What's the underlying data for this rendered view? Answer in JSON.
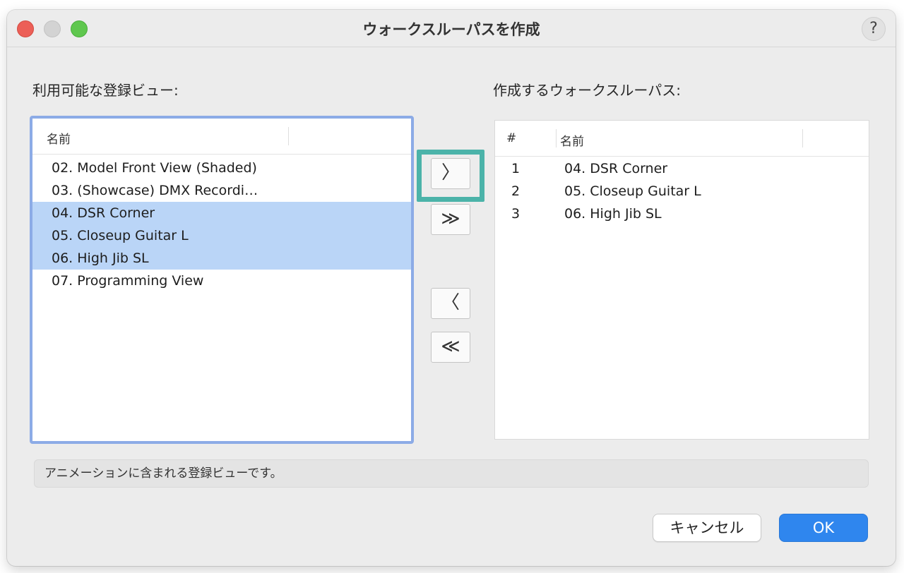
{
  "window": {
    "title": "ウォークスルーパスを作成",
    "help_label": "?"
  },
  "left_panel": {
    "label": "利用可能な登録ビュー:",
    "column_name": "名前",
    "items": [
      {
        "label": "02. Model Front View (Shaded)",
        "selected": false
      },
      {
        "label": "03. (Showcase) DMX Recordi…",
        "selected": false
      },
      {
        "label": "04. DSR Corner",
        "selected": true
      },
      {
        "label": "05. Closeup Guitar L",
        "selected": true
      },
      {
        "label": "06. High Jib SL",
        "selected": true
      },
      {
        "label": "07. Programming View",
        "selected": false
      }
    ]
  },
  "right_panel": {
    "label": "作成するウォークスルーパス:",
    "column_number": "#",
    "column_name": "名前",
    "items": [
      {
        "num": "1",
        "label": "04. DSR Corner"
      },
      {
        "num": "2",
        "label": "05. Closeup Guitar L"
      },
      {
        "num": "3",
        "label": "06. High Jib SL"
      }
    ]
  },
  "transfer_buttons": {
    "add": "〉",
    "add_all": "≫",
    "remove": "〈",
    "remove_all": "≪"
  },
  "status_text": "アニメーションに含まれる登録ビューです。",
  "footer": {
    "cancel_label": "キャンセル",
    "ok_label": "OK"
  },
  "colors": {
    "accent": "#2f86ee",
    "selection": "#bad5f7",
    "focus_ring": "#8cabe6",
    "highlight_frame": "#4bb3a9"
  }
}
